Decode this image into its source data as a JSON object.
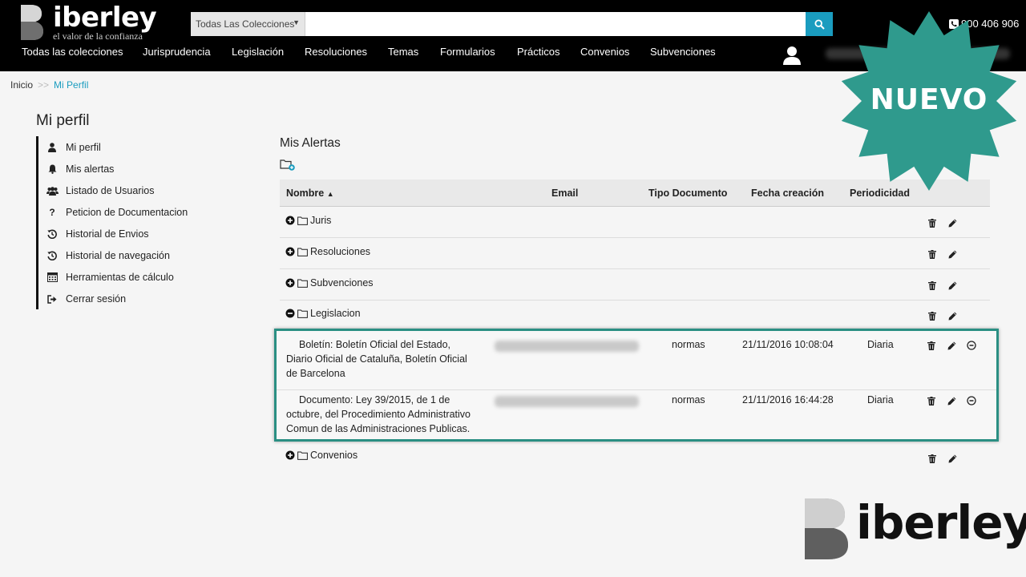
{
  "brand": {
    "name": "iberley",
    "tagline": "el valor de la confianza"
  },
  "search": {
    "collection": "Todas Las Colecciones",
    "placeholder": ""
  },
  "phone": "900 406 906",
  "nav": [
    "Todas las colecciones",
    "Jurisprudencia",
    "Legislación",
    "Resoluciones",
    "Temas",
    "Formularios",
    "Prácticos",
    "Convenios",
    "Subvenciones"
  ],
  "breadcrumb": {
    "home": "Inicio",
    "sep": ">>",
    "current": "Mi Perfil"
  },
  "sidebar": {
    "title": "Mi perfil",
    "items": [
      {
        "label": "Mi perfil",
        "icon": "user-icon"
      },
      {
        "label": "Mis alertas",
        "icon": "bell-icon"
      },
      {
        "label": "Listado de Usuarios",
        "icon": "users-icon"
      },
      {
        "label": "Peticion de Documentacion",
        "icon": "question-icon"
      },
      {
        "label": "Historial de Envios",
        "icon": "history-icon"
      },
      {
        "label": "Historial de navegación",
        "icon": "history-icon"
      },
      {
        "label": "Herramientas de cálculo",
        "icon": "calculator-icon"
      },
      {
        "label": "Cerrar sesión",
        "icon": "logout-icon"
      }
    ]
  },
  "main": {
    "title": "Mis Alertas",
    "columns": {
      "nombre": "Nombre",
      "email": "Email",
      "tipo": "Tipo Documento",
      "fecha": "Fecha creación",
      "periodicidad": "Periodicidad"
    },
    "folders": [
      {
        "name": "Juris",
        "expanded": false
      },
      {
        "name": "Resoluciones",
        "expanded": false
      },
      {
        "name": "Subvenciones",
        "expanded": false
      },
      {
        "name": "Legislacion",
        "expanded": true
      },
      {
        "name": "Convenios",
        "expanded": false
      }
    ],
    "alerts": [
      {
        "desc": "Boletín: Boletín Oficial del Estado, Diario Oficial de Cataluña, Boletín Oficial de Barcelona",
        "tipo": "normas",
        "fecha": "21/11/2016 10:08:04",
        "periodicidad": "Diaria"
      },
      {
        "desc": "Documento: Ley 39/2015, de 1 de octubre, del Procedimiento Administrativo Comun de las Administraciones Publicas.",
        "tipo": "normas",
        "fecha": "21/11/2016 16:44:28",
        "periodicidad": "Diaria"
      }
    ]
  },
  "badge": {
    "text": "NUEVO",
    "color": "#2f9a8d"
  },
  "colors": {
    "accent": "#1a9cbf",
    "highlight_border": "#2a8f83",
    "header_bg": "#000000"
  }
}
